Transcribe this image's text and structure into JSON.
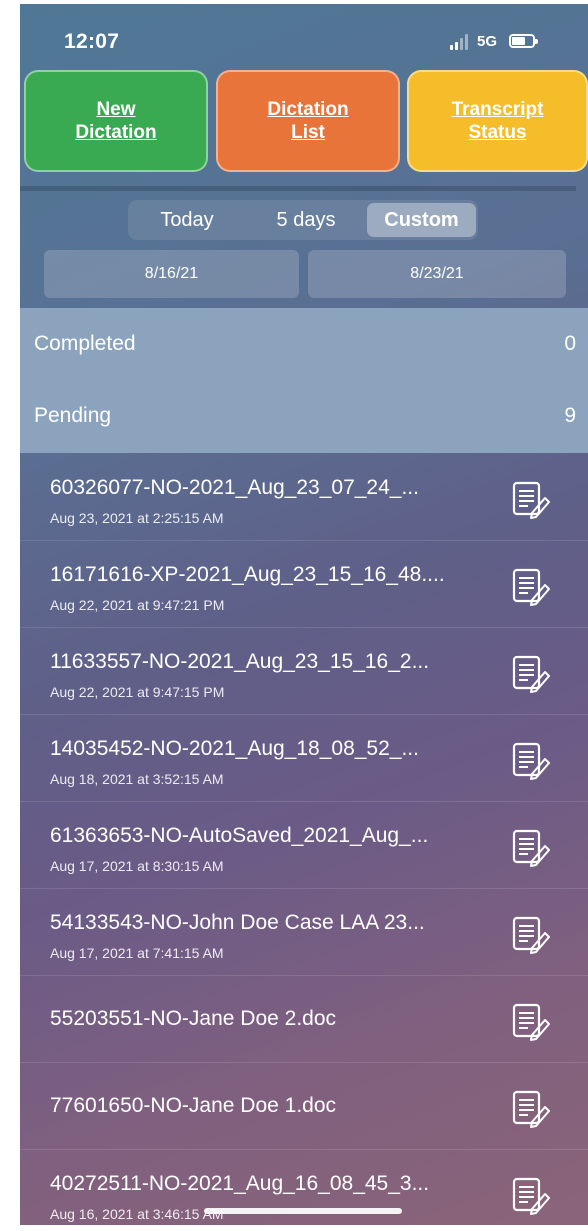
{
  "status_bar": {
    "time": "12:07",
    "network": "5G"
  },
  "top_buttons": {
    "new_dictation": "New Dictation",
    "dictation_list": "Dictation List",
    "transcript_status": "Transcript Status"
  },
  "colors": {
    "new_dictation": "#3aaa52",
    "dictation_list": "#e8743a",
    "transcript_status": "#f6bd2a"
  },
  "segments": {
    "today": "Today",
    "five_days": "5 days",
    "custom": "Custom",
    "selected": "Custom"
  },
  "date_range": {
    "start": "8/16/21",
    "end": "8/23/21"
  },
  "sections": {
    "completed": {
      "label": "Completed",
      "count": "0"
    },
    "pending": {
      "label": "Pending",
      "count": "9"
    }
  },
  "items": [
    {
      "title": "60326077-NO-2021_Aug_23_07_24_...",
      "date": "Aug 23, 2021 at 2:25:15 AM",
      "icon": "transcript-edit-icon"
    },
    {
      "title": "16171616-XP-2021_Aug_23_15_16_48....",
      "date": "Aug 22, 2021 at 9:47:21 PM",
      "icon": "transcript-edit-icon"
    },
    {
      "title": "11633557-NO-2021_Aug_23_15_16_2...",
      "date": "Aug 22, 2021 at 9:47:15 PM",
      "icon": "transcript-edit-icon"
    },
    {
      "title": "14035452-NO-2021_Aug_18_08_52_...",
      "date": "Aug 18, 2021 at 3:52:15 AM",
      "icon": "transcript-edit-icon"
    },
    {
      "title": "61363653-NO-AutoSaved_2021_Aug_...",
      "date": "Aug 17, 2021 at 8:30:15 AM",
      "icon": "transcript-edit-icon"
    },
    {
      "title": "54133543-NO-John Doe Case LAA 23...",
      "date": "Aug 17, 2021 at 7:41:15 AM",
      "icon": "transcript-edit-icon"
    },
    {
      "title": "55203551-NO-Jane Doe 2.doc",
      "date": "",
      "icon": "transcript-edit-icon"
    },
    {
      "title": "77601650-NO-Jane Doe 1.doc",
      "date": "",
      "icon": "transcript-edit-icon"
    },
    {
      "title": "40272511-NO-2021_Aug_16_08_45_3...",
      "date": "Aug 16, 2021 at 3:46:15 AM",
      "icon": "transcript-edit-icon"
    }
  ]
}
